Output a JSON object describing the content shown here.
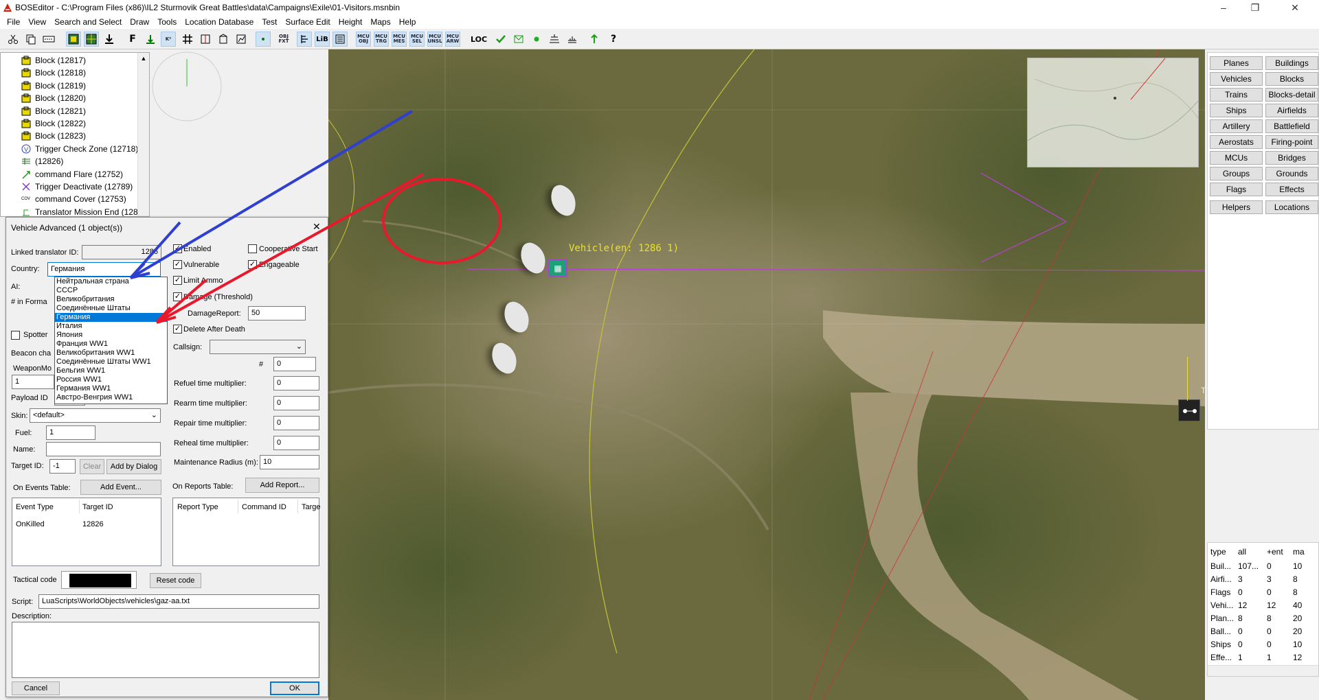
{
  "window": {
    "title": "BOSEditor - C:\\Program Files (x86)\\IL2 Sturmovik Great Battles\\data\\Campaigns\\Exile\\01-Visitors.msnbin"
  },
  "menu": [
    "File",
    "View",
    "Search and Select",
    "Draw",
    "Tools",
    "Location Database",
    "Test",
    "Surface Edit",
    "Height",
    "Maps",
    "Help"
  ],
  "toolbar": {
    "b10": "OBJ\nFXT",
    "b13": "LiB",
    "b14": "",
    "b15": "MCU\nOBJ",
    "b16": "MCU\nTRG",
    "b17": "MCU\nMES",
    "b18": "MCU\nSEL",
    "b19": "MCU\nUNSL",
    "b20": "MCU\nARW",
    "loc": "LOC"
  },
  "tree": [
    {
      "icon": "block-icon",
      "label": "Block (12817)"
    },
    {
      "icon": "block-icon",
      "label": "Block (12818)"
    },
    {
      "icon": "block-icon",
      "label": "Block (12819)"
    },
    {
      "icon": "block-icon",
      "label": "Block (12820)"
    },
    {
      "icon": "block-icon",
      "label": "Block (12821)"
    },
    {
      "icon": "block-icon",
      "label": "Block (12822)"
    },
    {
      "icon": "block-icon",
      "label": "Block (12823)"
    },
    {
      "icon": "trigger-icon",
      "label": "Trigger Check Zone (12718)"
    },
    {
      "icon": "translator-icon",
      "label": " (12826)"
    },
    {
      "icon": "flare-icon",
      "label": "command Flare (12752)"
    },
    {
      "icon": "deactivate-icon",
      "label": "Trigger Deactivate (12789)"
    },
    {
      "icon": "cover-icon",
      "label": "command Cover (12753)"
    },
    {
      "icon": "mission-end-icon",
      "label": "Translator Mission End (128"
    }
  ],
  "right_panel": {
    "buttons": [
      [
        "Planes",
        "Buildings"
      ],
      [
        "Vehicles",
        "Blocks"
      ],
      [
        "Trains",
        "Blocks-detail"
      ],
      [
        "Ships",
        "Airfields"
      ],
      [
        "Artillery",
        "Battlefield"
      ],
      [
        "Aerostats",
        "Firing-point"
      ],
      [
        "MCUs",
        "Bridges"
      ],
      [
        "Groups",
        "Grounds"
      ],
      [
        "Flags",
        "Effects"
      ],
      [
        "Helpers",
        "Locations"
      ]
    ]
  },
  "stats": {
    "headers": [
      "type",
      "all",
      "+ent",
      "ma"
    ],
    "rows": [
      [
        "Buil...",
        "107...",
        "0",
        "10"
      ],
      [
        "Airfi...",
        "3",
        "3",
        "8"
      ],
      [
        "Flags",
        "0",
        "0",
        "8"
      ],
      [
        "Vehi...",
        "12",
        "12",
        "40"
      ],
      [
        "Plan...",
        "8",
        "8",
        "20"
      ],
      [
        "Ball...",
        "0",
        "0",
        "20"
      ],
      [
        "Ships",
        "0",
        "0",
        "10"
      ],
      [
        "Effe...",
        "1",
        "1",
        "12"
      ]
    ]
  },
  "map": {
    "label": "Vehicle(en: 1286 1)",
    "t_marker": "T"
  },
  "dialog": {
    "title": "Vehicle Advanced (1 object(s))",
    "linked_translator_label": "Linked translator ID:",
    "linked_translator_value": "1286",
    "country_label": "Country:",
    "country_value": "Германия",
    "country_options": [
      "Нейтральная страна",
      "СССР",
      "Великобритания",
      "Соединённые Штаты",
      "Германия",
      "Италия",
      "Япония",
      "Франция WW1",
      "Великобритания WW1",
      "Соединённые Штаты WW1",
      "Бельгия WW1",
      "Россия WW1",
      "Германия WW1",
      "Австро-Венгрия WW1"
    ],
    "ai_label": "AI:",
    "in_formation_label": "# in Forma",
    "spotter_label": "Spotter",
    "beacon_label": "Beacon cha",
    "weapon_label": "WeaponMo",
    "weapon_value": "1",
    "payload_label": "Payload ID",
    "skin_label": "Skin:",
    "skin_value": "<default>",
    "fuel_label": "Fuel:",
    "fuel_value": "1",
    "name_label": "Name:",
    "name_value": "",
    "target_label": "Target ID:",
    "target_value": "-1",
    "clear_label": "Clear",
    "add_dialog_label": "Add by Dialog",
    "enabled": "Enabled",
    "coop_start": "Cooperative Start",
    "vulnerable": "Vulnerable",
    "engageable": "Engageable",
    "limit_ammo": "Limit Ammo",
    "damage_threshold": "Damage (Threshold)",
    "damage_report_label": "DamageReport:",
    "damage_report_value": "50",
    "delete_after_death": "Delete After Death",
    "callsign_label": "Callsign:",
    "callsign_value": "",
    "num_label": "#",
    "num_value": "0",
    "refuel_label": "Refuel time multiplier:",
    "refuel_value": "0",
    "rearm_label": "Rearm time multiplier:",
    "rearm_value": "0",
    "repair_label": "Repair time multiplier:",
    "repair_value": "0",
    "reheal_label": "Reheal time multiplier:",
    "reheal_value": "0",
    "maint_label": "Maintenance Radius (m):",
    "maint_value": "10",
    "events_label": "On Events Table:",
    "add_event": "Add Event...",
    "events_headers": [
      "Event Type",
      "Target ID"
    ],
    "events_rows": [
      [
        "OnKilled",
        "12826"
      ]
    ],
    "reports_label": "On Reports Table:",
    "add_report": "Add Report...",
    "reports_headers": [
      "Report Type",
      "Command ID",
      "Targe"
    ],
    "tactical_label": "Tactical code",
    "reset_code": "Reset code",
    "script_label": "Script:",
    "script_value": "LuaScripts\\WorldObjects\\vehicles\\gaz-aa.txt",
    "description_label": "Description:",
    "description_value": "",
    "cancel": "Cancel",
    "ok": "OK"
  },
  "colors": {
    "highlight": "#0078d7",
    "annotation_red": "#e8192c",
    "annotation_blue": "#2f3fcf",
    "path_magenta": "#b93fd6"
  }
}
